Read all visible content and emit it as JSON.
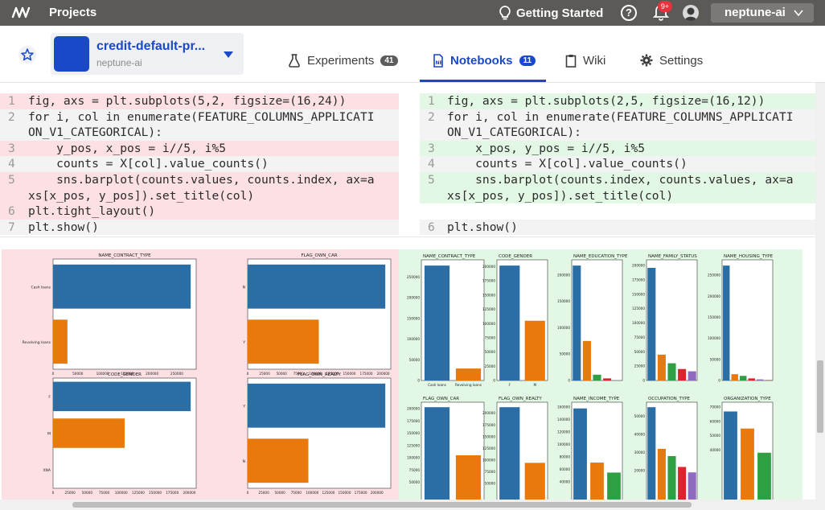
{
  "topbar": {
    "title": "Projects",
    "getting_started": "Getting Started",
    "notifications_badge": "9+",
    "org_name": "neptune-ai"
  },
  "project": {
    "name": "credit-default-pr...",
    "org": "neptune-ai"
  },
  "tabs": [
    {
      "label": "Experiments",
      "count": "41",
      "icon": "flask-icon",
      "active": false
    },
    {
      "label": "Notebooks",
      "count": "11",
      "icon": "notebook-icon",
      "active": true
    },
    {
      "label": "Wiki",
      "icon": "clipboard-icon",
      "active": false
    },
    {
      "label": "Settings",
      "icon": "gear-icon",
      "active": false
    }
  ],
  "diff": {
    "left_line_numbers": [
      "1",
      "2",
      "",
      "3",
      "4",
      "5",
      "",
      "6",
      "7"
    ],
    "right_line_numbers": [
      "1",
      "2",
      "",
      "3",
      "4",
      "5",
      "",
      "",
      "6"
    ],
    "left_lines": [
      "fig, axs = plt.subplots(5,2, figsize=(16,24))",
      "for i, col in enumerate(FEATURE_COLUMNS_APPLICATI",
      "ON_V1_CATEGORICAL):",
      "    y_pos, x_pos = i//5, i%5",
      "    counts = X[col].value_counts()",
      "    sns.barplot(counts.values, counts.index, ax=a",
      "xs[x_pos, y_pos]).set_title(col)",
      "plt.tight_layout()",
      "plt.show()"
    ],
    "right_lines": [
      "fig, axs = plt.subplots(2,5, figsize=(16,12))",
      "for i, col in enumerate(FEATURE_COLUMNS_APPLICATI",
      "ON_V1_CATEGORICAL):",
      "    x_pos, y_pos = i//5, i%5",
      "    counts = X[col].value_counts()",
      "    sns.barplot(counts.index, counts.values, ax=a",
      "xs[x_pos, y_pos]).set_title(col)",
      "",
      "plt.show()"
    ]
  },
  "colors": {
    "accent": "#1a49c7",
    "bar_blue": "#2a6ea5",
    "bar_orange": "#e8790d",
    "bar_green": "#2ea043",
    "bar_red": "#d9252c",
    "bar_purple": "#8e6bbf",
    "removed_bg": "#fde0e3",
    "added_bg": "#e2f8e4"
  },
  "chart_data": [
    {
      "panel": "left",
      "type": "bar",
      "orientation": "horizontal",
      "title": "NAME_CONTRACT_TYPE",
      "categories": [
        "Cash loans",
        "Revolving loans"
      ],
      "values": [
        278000,
        29000
      ],
      "xticks": [
        "0",
        "50000",
        "100000",
        "150000",
        "200000",
        "250000"
      ]
    },
    {
      "panel": "left",
      "type": "bar",
      "orientation": "horizontal",
      "title": "FLAG_OWN_CAR",
      "categories": [
        "N",
        "Y"
      ],
      "values": [
        203000,
        105000
      ],
      "xticks": [
        "0",
        "25000",
        "50000",
        "75000",
        "100000",
        "125000",
        "150000",
        "175000",
        "200000"
      ]
    },
    {
      "panel": "left",
      "type": "bar",
      "orientation": "horizontal",
      "title": "CODE_GENDER",
      "categories": [
        "F",
        "M",
        "XNA"
      ],
      "values": [
        202000,
        105000,
        4
      ],
      "xticks": [
        "0",
        "25000",
        "50000",
        "75000",
        "100000",
        "125000",
        "150000",
        "175000",
        "200000"
      ]
    },
    {
      "panel": "left",
      "type": "bar",
      "orientation": "horizontal",
      "title": "FLAG_OWN_REALTY",
      "categories": [
        "Y",
        "N"
      ],
      "values": [
        213000,
        94000
      ],
      "xticks": [
        "0",
        "25000",
        "50000",
        "75000",
        "100000",
        "125000",
        "150000",
        "175000",
        "200000"
      ]
    },
    {
      "panel": "right",
      "type": "bar",
      "title": "NAME_CONTRACT_TYPE",
      "categories": [
        "Cash loans",
        "Revolving loans"
      ],
      "values": [
        278000,
        29000
      ],
      "yticks": [
        "0",
        "50000",
        "100000",
        "150000",
        "200000",
        "250000"
      ]
    },
    {
      "panel": "right",
      "type": "bar",
      "title": "CODE_GENDER",
      "categories": [
        "F",
        "M"
      ],
      "values": [
        202000,
        105000
      ],
      "yticks": [
        "0",
        "25000",
        "50000",
        "75000",
        "100000",
        "125000",
        "150000",
        "175000",
        "200000"
      ]
    },
    {
      "panel": "right",
      "type": "bar",
      "title": "NAME_EDUCATION_TYPE",
      "values": [
        218000,
        75000,
        11000,
        4000,
        200
      ],
      "yticks": [
        "0",
        "50000",
        "100000",
        "150000",
        "200000"
      ]
    },
    {
      "panel": "right",
      "type": "bar",
      "title": "NAME_FAMILY_STATUS",
      "values": [
        196000,
        45000,
        30000,
        20000,
        16000
      ],
      "yticks": [
        "0",
        "25000",
        "50000",
        "75000",
        "100000",
        "125000",
        "150000",
        "175000",
        "200000"
      ]
    },
    {
      "panel": "right",
      "type": "bar",
      "title": "NAME_HOUSING_TYPE",
      "values": [
        273000,
        15000,
        11000,
        5000,
        2600,
        1100
      ],
      "yticks": [
        "0",
        "50000",
        "100000",
        "150000",
        "200000",
        "250000"
      ]
    },
    {
      "panel": "right",
      "type": "bar",
      "title": "FLAG_OWN_CAR",
      "values": [
        203000,
        105000
      ],
      "yticks": [
        "50000",
        "75000",
        "100000",
        "125000",
        "150000",
        "175000",
        "200000"
      ]
    },
    {
      "panel": "right",
      "type": "bar",
      "title": "FLAG_OWN_REALTY",
      "values": [
        213000,
        94000
      ],
      "yticks": [
        "50000",
        "75000",
        "100000",
        "125000",
        "150000",
        "175000",
        "200000"
      ]
    },
    {
      "panel": "right",
      "type": "bar",
      "title": "NAME_INCOME_TYPE",
      "values": [
        158000,
        71000,
        55000
      ],
      "yticks": [
        "40000",
        "60000",
        "80000",
        "100000",
        "120000",
        "140000",
        "160000"
      ]
    },
    {
      "panel": "right",
      "type": "bar",
      "title": "OCCUPATION_TYPE",
      "values": [
        55000,
        32000,
        28000,
        22000,
        19000
      ],
      "yticks": [
        "20000",
        "30000",
        "40000",
        "50000"
      ]
    },
    {
      "panel": "right",
      "type": "bar",
      "title": "ORGANIZATION_TYPE",
      "values": [
        67000,
        55000,
        38000
      ],
      "yticks": [
        "40000",
        "50000",
        "60000",
        "70000"
      ]
    }
  ]
}
